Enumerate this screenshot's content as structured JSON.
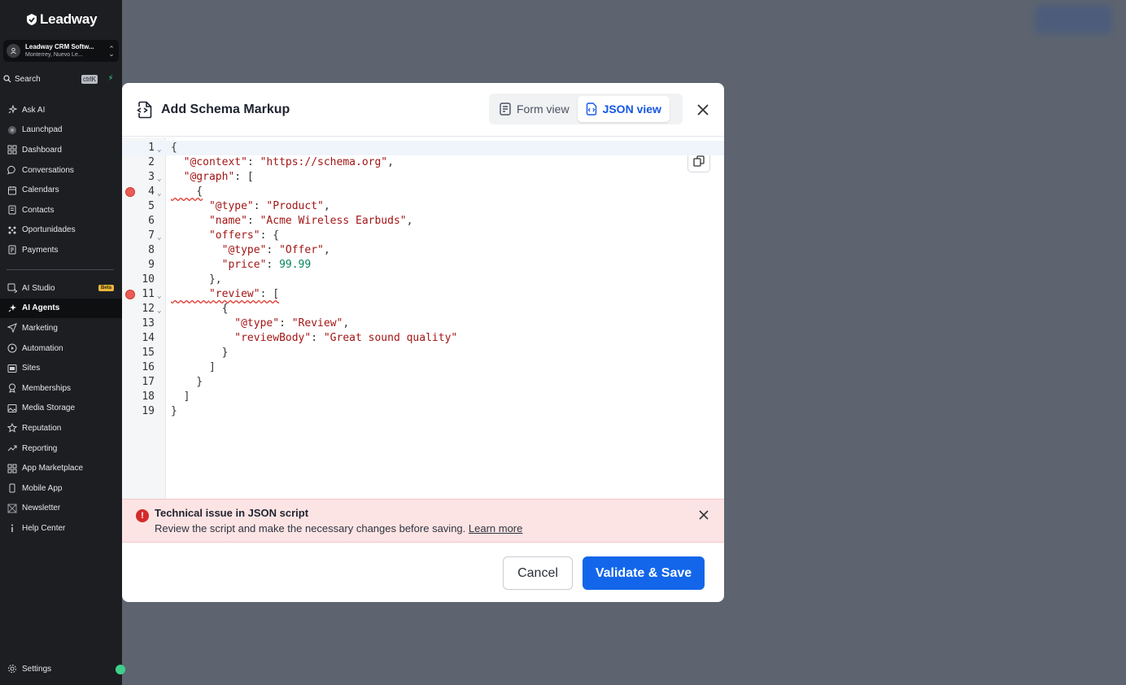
{
  "sidebar": {
    "logo": "Leadway",
    "account": {
      "name": "Leadway CRM Softw...",
      "location": "Monterrey, Nuevo Le..."
    },
    "search": {
      "label": "Search",
      "shortcut": "ctrlK"
    },
    "items": [
      {
        "label": "Ask AI",
        "icon": "sparkle-icon"
      },
      {
        "label": "Launchpad",
        "icon": "launchpad-icon"
      },
      {
        "label": "Dashboard",
        "icon": "grid-icon"
      },
      {
        "label": "Conversations",
        "icon": "chat-icon"
      },
      {
        "label": "Calendars",
        "icon": "calendar-icon"
      },
      {
        "label": "Contacts",
        "icon": "contacts-icon"
      },
      {
        "label": "Oportunidades",
        "icon": "pipeline-icon"
      },
      {
        "label": "Payments",
        "icon": "payments-icon"
      }
    ],
    "items2": [
      {
        "label": "AI Studio",
        "icon": "ai-studio-icon",
        "badge": "Beta"
      },
      {
        "label": "AI Agents",
        "icon": "sparkle-icon",
        "active": true
      },
      {
        "label": "Marketing",
        "icon": "send-icon"
      },
      {
        "label": "Automation",
        "icon": "automation-icon"
      },
      {
        "label": "Sites",
        "icon": "sites-icon"
      },
      {
        "label": "Memberships",
        "icon": "memberships-icon"
      },
      {
        "label": "Media Storage",
        "icon": "image-icon"
      },
      {
        "label": "Reputation",
        "icon": "star-icon"
      },
      {
        "label": "Reporting",
        "icon": "trend-icon"
      },
      {
        "label": "App Marketplace",
        "icon": "apps-icon"
      },
      {
        "label": "Mobile App",
        "icon": "mobile-icon"
      },
      {
        "label": "Newsletter",
        "icon": "newsletter-icon"
      },
      {
        "label": "Help Center",
        "icon": "info-icon"
      }
    ],
    "settings": "Settings"
  },
  "modal": {
    "title": "Add Schema Markup",
    "tabs": {
      "form": "Form view",
      "json": "JSON view"
    },
    "active_tab": "json",
    "code_lines": [
      "{",
      "  \"@context\": \"https://schema.org\",",
      "  \"@graph\": [",
      "    {",
      "      \"@type\": \"Product\",",
      "      \"name\": \"Acme Wireless Earbuds\",",
      "      \"offers\": {",
      "        \"@type\": \"Offer\",",
      "        \"price\": 99.99",
      "      },",
      "      \"review\": [",
      "        {",
      "          \"@type\": \"Review\",",
      "          \"reviewBody\": \"Great sound quality\"",
      "        }",
      "      ]",
      "    }",
      "  ]",
      "}"
    ],
    "error_lines": [
      4,
      11
    ],
    "fold_lines": [
      1,
      3,
      4,
      7,
      11,
      12
    ],
    "alert": {
      "title": "Technical issue in JSON script",
      "message": "Review the script and make the necessary changes before saving.",
      "link": "Learn more"
    },
    "buttons": {
      "cancel": "Cancel",
      "save": "Validate & Save"
    },
    "colors": {
      "primary": "#1366ea",
      "error": "#d42a2a",
      "alert_bg": "#fde4e4"
    }
  }
}
